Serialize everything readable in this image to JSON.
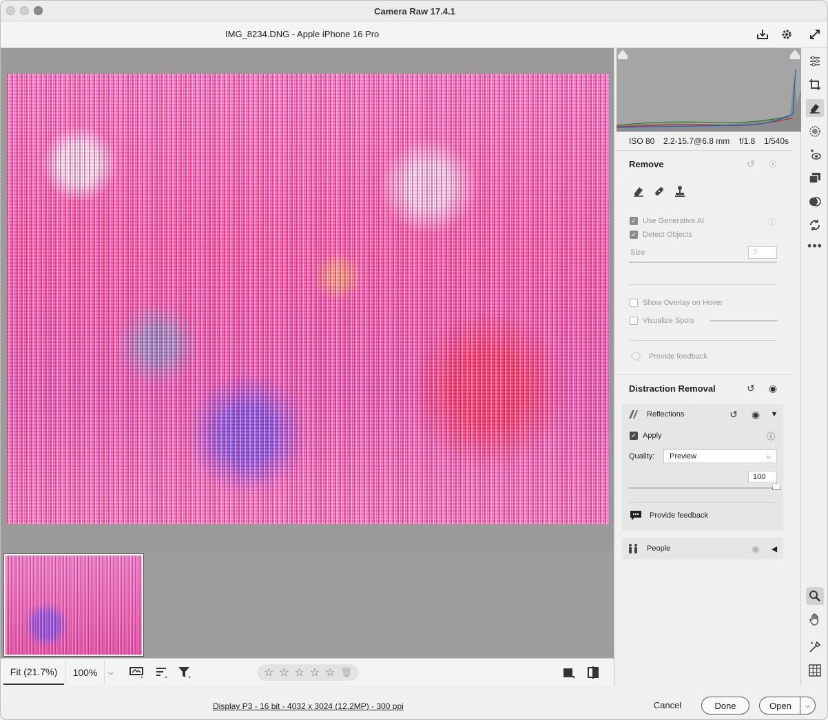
{
  "window": {
    "title": "Camera Raw 17.4.1"
  },
  "header": {
    "filename": "IMG_8234.DNG  -  Apple iPhone 16 Pro"
  },
  "bottom_toolbar": {
    "zoom_fit": "Fit (21.7%)",
    "zoom_100": "100%",
    "stars": [
      "☆",
      "☆",
      "☆",
      "☆",
      "☆"
    ]
  },
  "status": {
    "display_info": "Display P3 - 16 bit - 4032 x 3024 (12.2MP) - 300 ppi",
    "cancel": "Cancel",
    "done": "Done",
    "open": "Open"
  },
  "exif": {
    "iso": "ISO 80",
    "focal": "2.2-15.7@6.8 mm",
    "aperture": "f/1.8",
    "shutter": "1/540s"
  },
  "remove": {
    "title": "Remove",
    "use_generative_ai": "Use Generative AI",
    "detect_objects": "Detect Objects",
    "size_label": "Size",
    "size_value": "7",
    "show_overlay": "Show Overlay on Hover",
    "visualize_spots": "Visualize Spots",
    "feedback": "Provide feedback"
  },
  "distraction": {
    "title": "Distraction Removal",
    "reflections": {
      "label": "Reflections",
      "apply": "Apply",
      "quality_label": "Quality:",
      "quality_value": "Preview",
      "amount": "100",
      "amount_fraction": 1.0,
      "feedback": "Provide feedback"
    },
    "people": {
      "label": "People"
    }
  }
}
